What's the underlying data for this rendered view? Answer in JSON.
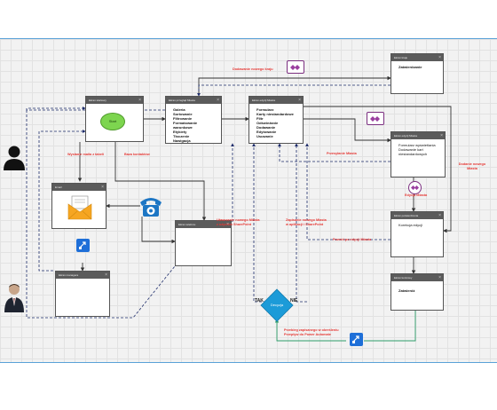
{
  "nodes": {
    "start_window": {
      "title": "Ekran startowy",
      "start_label": "Start"
    },
    "gallery_window": {
      "title": "Ekran przegląd Miasta",
      "lines": [
        "Galeria",
        "Sortowanie",
        "Filtrowanie",
        "Formatowanie warunkowe",
        "Etykiety",
        "Tłoczenie",
        "Nawigacja"
      ]
    },
    "form_window": {
      "title": "Ekran edycji Miasta",
      "lines": [
        "Formularz",
        "Karty niestandardowe",
        "Filtr",
        "Odświeżanie",
        "Dodawanie",
        "Edytowanie",
        "Usuwanie"
      ]
    },
    "country_window": {
      "title": "Ekran kraju",
      "lines": [
        "Zatwierdzanie"
      ]
    },
    "city_detail_window": {
      "title": "Ekran edycji Miasta",
      "lines": [
        "Formularz wyświetlania",
        "Dodawanie kart",
        "niestandardowych"
      ]
    },
    "email_window": {
      "title": "Email"
    },
    "call_window": {
      "title": "Ekran telefonu"
    },
    "edit_confirm_window": {
      "title": "Ekran potwierdzenia",
      "lines": [
        "Korekcja edycji"
      ]
    },
    "manager_window": {
      "title": "Ekran managera"
    },
    "final_window": {
      "title": "Ekran końcowy",
      "lines": [
        "Zatwierdź"
      ]
    },
    "decision": {
      "label": "Decyzja",
      "yes": "TAK",
      "no": "NIE"
    }
  },
  "edges": {
    "add_country": "Dodawanie nowego kraju",
    "send_email": "Wysłanie maila z tabeli",
    "database": "Baza kontaktów",
    "city_transfer": "Przesyłanie Miasta",
    "add_new_city": "Dodanie nowego Miasta",
    "edit_city": "Edycja Miasta",
    "create_new_city_1": "Utworzenie nowego Miasta",
    "create_new_city_2": "z użyciem SharePoint",
    "save_new_city_1": "Zapisanie nowego Miasta",
    "save_new_city_2": "w aplikacji i SharePoint",
    "confirm_edit": "Powrót po edycji Miasta",
    "trigger_1": "Przebieg zapisanego w określeniu",
    "trigger_2": "Przepływ do Power Automate"
  }
}
